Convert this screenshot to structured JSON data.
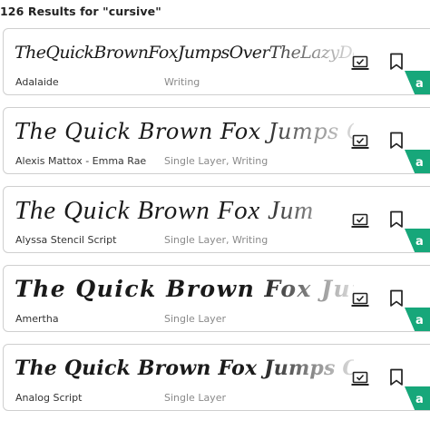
{
  "results": {
    "header_text": "126 Results for \"cursive\""
  },
  "colors": {
    "accent": "#17a77a",
    "border": "#cfcfcf",
    "tag_text": "#8a8a8a"
  },
  "icons": {
    "laptop": "laptop-icon",
    "bookmark": "bookmark-icon"
  },
  "fonts": [
    {
      "preview": "TheQuickBrownFoxJumpsOverTheLazyDog",
      "name": "Adalaide",
      "tags": "Writing",
      "badge": "a"
    },
    {
      "preview": "The Quick Brown Fox Jumps O",
      "name": "Alexis Mattox - Emma Rae",
      "tags": "Single Layer, Writing",
      "badge": "a"
    },
    {
      "preview": "The Quick Brown Fox Jum",
      "name": "Alyssa Stencil Script",
      "tags": "Single Layer, Writing",
      "badge": "a"
    },
    {
      "preview": "The Quick Brown Fox Jump",
      "name": "Amertha",
      "tags": "Single Layer",
      "badge": "a"
    },
    {
      "preview": "The Quick Brown Fox Jumps O",
      "name": "Analog Script",
      "tags": "Single Layer",
      "badge": "a"
    }
  ]
}
